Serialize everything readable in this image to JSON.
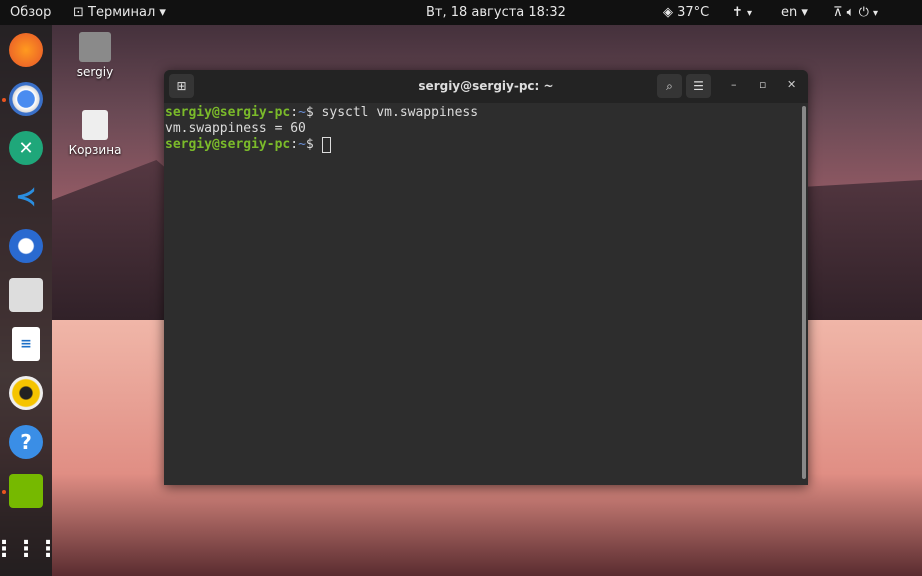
{
  "topbar": {
    "overview": "Обзор",
    "app_menu": "Терминал ▾",
    "clock": "Вт, 18 августа  18:32",
    "weather": "37°C",
    "accessibility": "▾",
    "lang": "en ▾",
    "system": "▾"
  },
  "desktop": {
    "home": "sergiy",
    "trash": "Корзина"
  },
  "dock": [
    "Firefox",
    "Chromium",
    "Remmina",
    "VS Code",
    "Thunderbird",
    "Files",
    "LibreOffice Writer",
    "Rhythmbox",
    "Help",
    "Nvidia",
    "Show Applications"
  ],
  "terminal": {
    "title": "sergiy@sergiy-pc: ~",
    "lines": [
      {
        "user": "sergiy@sergiy-pc",
        "sep": ":",
        "path": "~",
        "prompt": "$ ",
        "cmd": "sysctl vm.swappiness"
      },
      {
        "output": "vm.swappiness = 60"
      },
      {
        "user": "sergiy@sergiy-pc",
        "sep": ":",
        "path": "~",
        "prompt": "$ ",
        "cmd": ""
      }
    ]
  }
}
